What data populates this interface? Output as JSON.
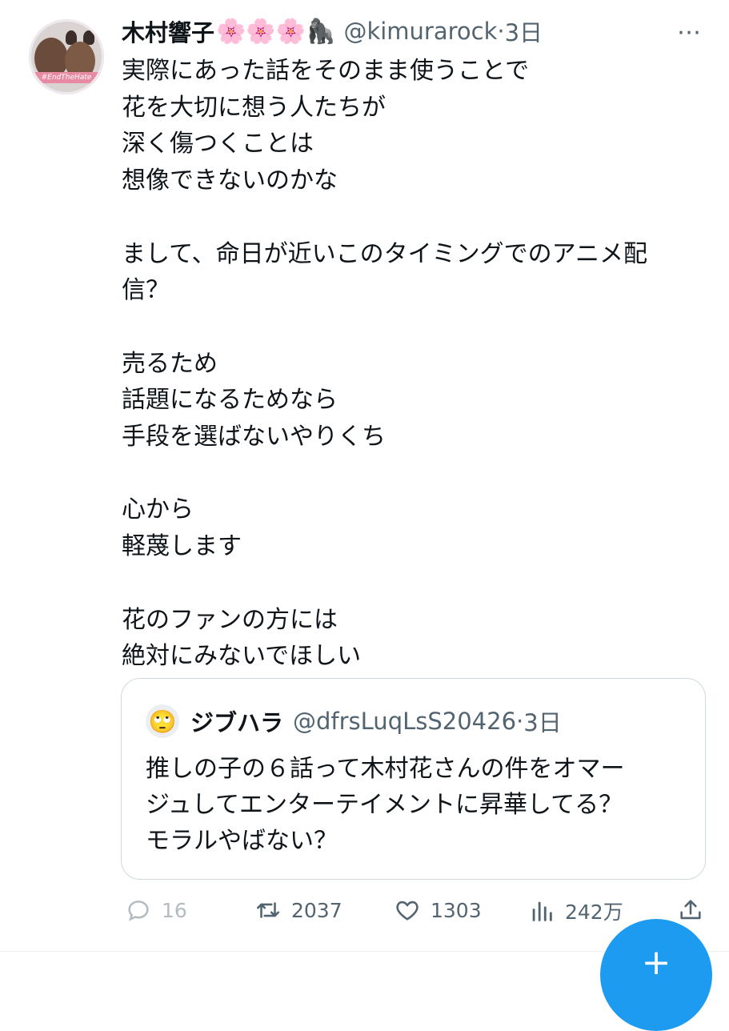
{
  "tweet": {
    "author_name": "木村響子",
    "author_emojis": "🌸🌸🌸🦍",
    "author_handle": "@kimurarock",
    "separator": "·",
    "time": "3日",
    "avatar_tag": "#EndTheHate",
    "more_icon": "⋯",
    "text": "実際にあった話をそのまま使うことで\n花を大切に想う人たちが\n深く傷つくことは\n想像できないのかな\n\nまして、命日が近いこのタイミングでのアニメ配\n信？\n\n売るため\n話題になるためなら\n手段を選ばないやりくち\n\n心から\n軽蔑します\n\n花のファンの方には\n絶対にみないでほしい"
  },
  "quoted_tweet": {
    "avatar_emoji": "🙄",
    "author_name": "ジブハラ",
    "author_handle": "@dfrsLuqLsS20426",
    "separator": "·",
    "time": "3日",
    "text": "推しの子の６話って木村花さんの件をオマー\nジュしてエンターテイメントに昇華してる？\nモラルやばない？"
  },
  "actions": {
    "reply_count": "16",
    "retweet_count": "2037",
    "like_count": "1303",
    "views_count": "242万"
  },
  "fab": {
    "icon": "+"
  },
  "colors": {
    "text": "#0f1419",
    "secondary": "#536471",
    "accent": "#1d9bf0",
    "border": "#cfd9de"
  },
  "icons": [
    "reply-icon",
    "retweet-icon",
    "like-icon",
    "views-icon",
    "share-icon",
    "compose-icon",
    "more-icon"
  ]
}
